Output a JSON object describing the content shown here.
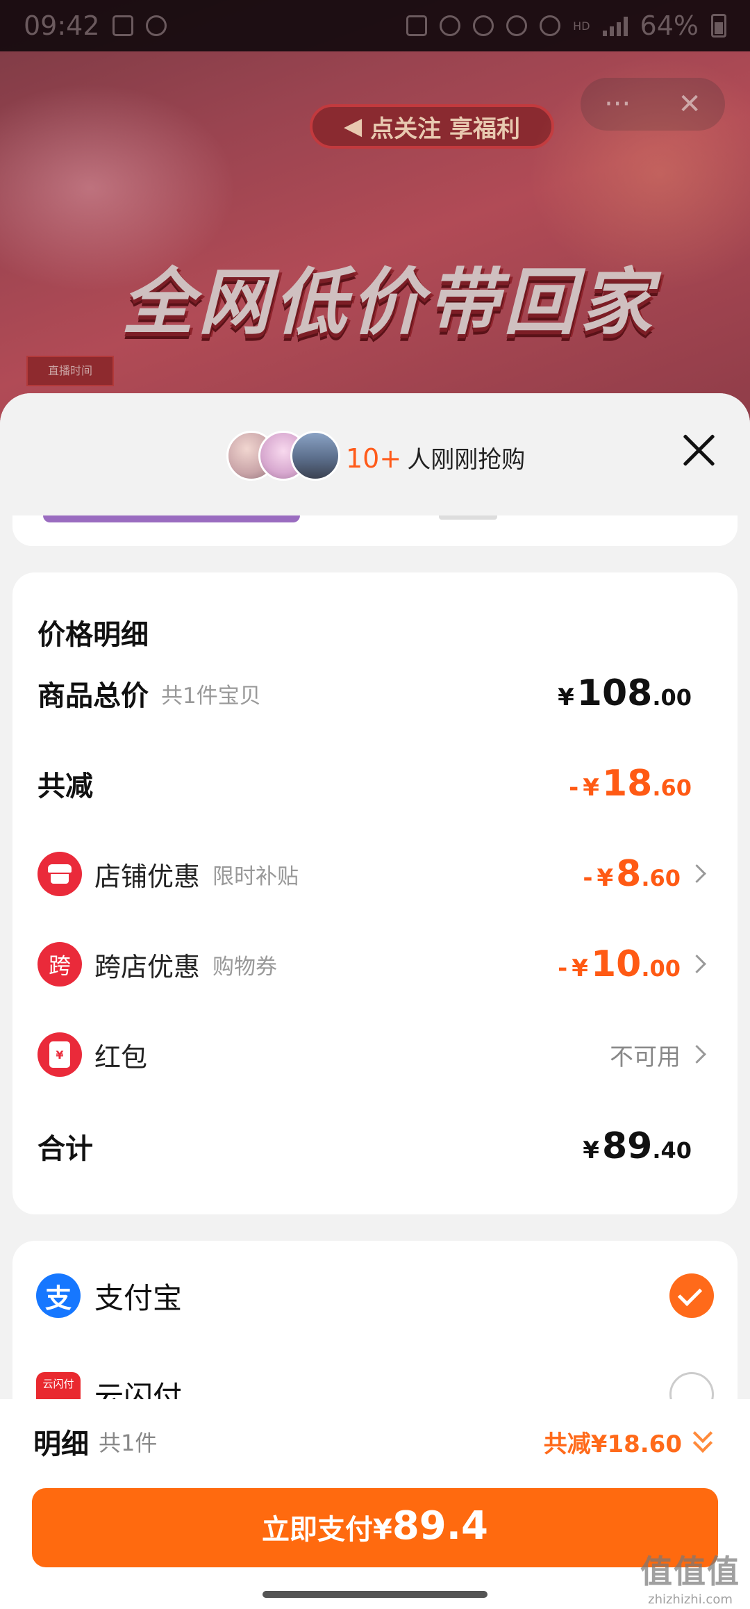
{
  "status_bar": {
    "time": "09:42",
    "battery": "64%",
    "net_label": "HD"
  },
  "live": {
    "follow_banner": "点关注 享福利",
    "headline": "全网低价带回家",
    "time_tag": "直播时间",
    "controls_more": "···",
    "controls_close": "✕"
  },
  "sheet": {
    "buyers_count": "10+",
    "buyers_text": "人刚刚抢购"
  },
  "price_detail": {
    "title": "价格明细",
    "goods_total": {
      "label": "商品总价",
      "sub": "共1件宝贝",
      "currency": "¥",
      "int": "108",
      "dec": ".00"
    },
    "total_discount": {
      "label": "共减",
      "minus": "-",
      "currency": "¥",
      "int": "18",
      "dec": ".60"
    },
    "store_discount": {
      "label": "店铺优惠",
      "sub": "限时补贴",
      "minus": "-",
      "currency": "¥",
      "int": "8",
      "dec": ".60"
    },
    "cross_store_discount": {
      "icon_text": "跨",
      "label": "跨店优惠",
      "sub": "购物券",
      "minus": "-",
      "currency": "¥",
      "int": "10",
      "dec": ".00"
    },
    "red_packet": {
      "icon_text": "¥",
      "label": "红包",
      "status": "不可用"
    },
    "sum": {
      "label": "合计",
      "currency": "¥",
      "int": "89",
      "dec": ".40"
    }
  },
  "payment": {
    "alipay": {
      "icon_text": "支",
      "label": "支付宝",
      "selected": true
    },
    "yunshanfu": {
      "icon_text": "云闪付",
      "label": "云闪付",
      "selected": false
    }
  },
  "footer": {
    "title": "明细",
    "sub": "共1件",
    "discount": "共减¥18.60",
    "pay_label": "立即支付¥",
    "pay_amount": "89.4"
  },
  "watermark": {
    "logo": "值值值",
    "url": "zhizhizhi.com"
  },
  "colors": {
    "accent": "#ff6a0f",
    "discount": "#ff5a14",
    "alipay": "#1677ff",
    "badge_red": "#ea2a3a"
  }
}
